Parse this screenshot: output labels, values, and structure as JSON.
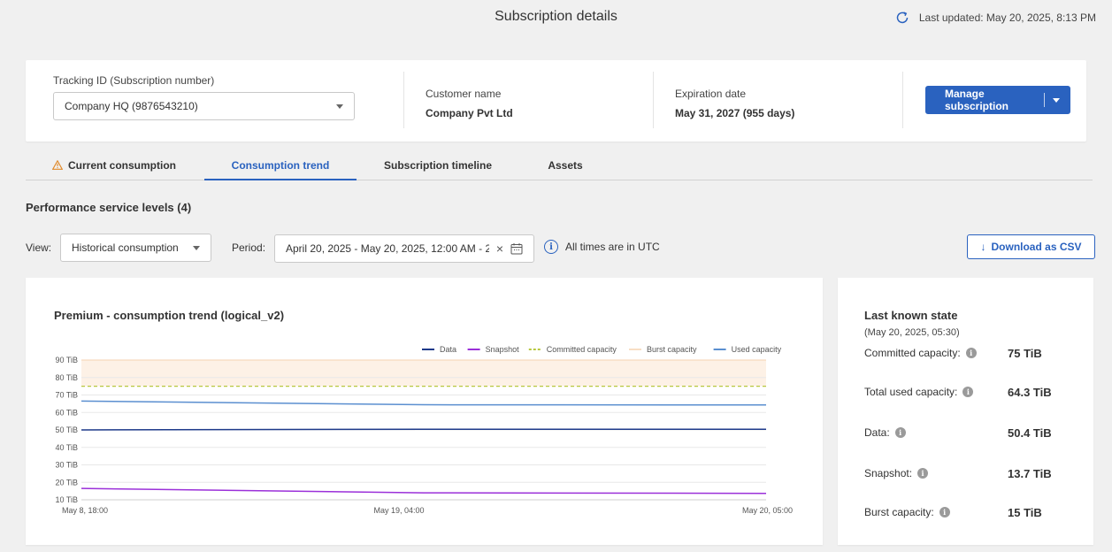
{
  "header": {
    "title": "Subscription details",
    "last_updated": "Last updated: May 20, 2025, 8:13 PM",
    "refresh_icon": "refresh-icon"
  },
  "details": {
    "tracking_label": "Tracking ID (Subscription number)",
    "tracking_value": "Company HQ (9876543210)",
    "customer_label": "Customer name",
    "customer_value": "Company Pvt Ltd",
    "expiration_label": "Expiration date",
    "expiration_value": "May 31, 2027 (955 days)",
    "manage_button": "Manage subscription"
  },
  "tabs": [
    {
      "label": "Current consumption",
      "icon": "warning-icon",
      "active": false
    },
    {
      "label": "Consumption trend",
      "active": true
    },
    {
      "label": "Subscription timeline",
      "active": false
    },
    {
      "label": "Assets",
      "active": false
    }
  ],
  "section": {
    "title": "Performance service levels (4)"
  },
  "filters": {
    "view_label": "View:",
    "view_value": "Historical consumption",
    "period_label": "Period:",
    "period_value": "April 20, 2025 - May 20, 2025, 12:00 AM - 2...",
    "clear_glyph": "×",
    "utc_note": "All times are in UTC",
    "info_glyph": "i",
    "csv_glyph": "↓",
    "download_button": "Download as CSV"
  },
  "colors": {
    "accent": "#2a62bf",
    "data": "#1e3a8a",
    "snapshot": "#9b30d9",
    "committed": "#b8c840",
    "burst": "#f5d2b0",
    "used": "#5b8fd0"
  },
  "chart_data": {
    "type": "line",
    "title": "Premium - consumption trend (logical_v2)",
    "x": [
      "May 8, 18:00",
      "May 19, 04:00",
      "May 20, 05:00"
    ],
    "ylim": [
      10,
      90
    ],
    "yticks": [
      90,
      80,
      70,
      60,
      50,
      40,
      30,
      20,
      10
    ],
    "y_unit": "TiB",
    "tick_labels": [
      "90 TiB",
      "80 TiB",
      "70 TiB",
      "60 TiB",
      "50 TiB",
      "40 TiB",
      "30 TiB",
      "20 TiB",
      "10 TiB"
    ],
    "series": [
      {
        "name": "Data",
        "values": [
          50.0,
          50.4,
          50.4
        ]
      },
      {
        "name": "Snapshot",
        "values": [
          16.5,
          14.0,
          13.7
        ]
      },
      {
        "name": "Committed capacity",
        "values": [
          75,
          75,
          75
        ]
      },
      {
        "name": "Burst capacity",
        "values": [
          90,
          90,
          90
        ]
      },
      {
        "name": "Used capacity",
        "values": [
          66.5,
          64.4,
          64.3
        ]
      }
    ],
    "legend_position": "top-right",
    "grid": true
  },
  "state": {
    "title": "Last known state",
    "subtitle": "(May 20, 2025, 05:30)",
    "info_glyph": "i",
    "rows": [
      {
        "label": "Committed capacity:",
        "value": "75 TiB"
      },
      {
        "label": "Total used capacity:",
        "value": "64.3 TiB"
      },
      {
        "label": "Data:",
        "value": "50.4 TiB"
      },
      {
        "label": "Snapshot:",
        "value": "13.7 TiB"
      },
      {
        "label": "Burst capacity:",
        "value": "15 TiB"
      }
    ]
  }
}
